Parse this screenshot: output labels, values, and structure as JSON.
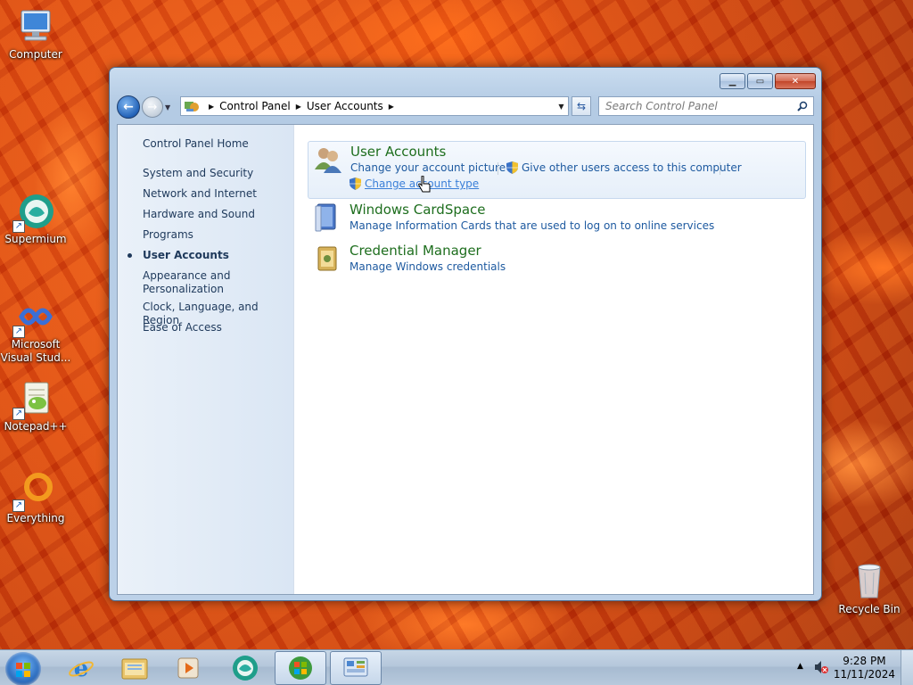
{
  "desktop": {
    "icons": [
      {
        "label": "Computer"
      },
      {
        "label": "Supermium"
      },
      {
        "label": "Microsoft Visual Stud..."
      },
      {
        "label": "Notepad++"
      },
      {
        "label": "Everything"
      },
      {
        "label": "Recycle Bin"
      }
    ]
  },
  "window": {
    "caption_buttons": {
      "minimize": "minimize-icon",
      "maximize": "maximize-icon",
      "close": "close-icon"
    },
    "address": {
      "crumbs": [
        "Control Panel",
        "User Accounts"
      ]
    },
    "search": {
      "placeholder": "Search Control Panel"
    },
    "left_pane": {
      "home": "Control Panel Home",
      "items": [
        {
          "label": "System and Security"
        },
        {
          "label": "Network and Internet"
        },
        {
          "label": "Hardware and Sound"
        },
        {
          "label": "Programs"
        },
        {
          "label": "User Accounts",
          "current": true
        },
        {
          "label": "Appearance and Personalization"
        },
        {
          "label": "Clock, Language, and Region"
        },
        {
          "label": "Ease of Access"
        }
      ]
    },
    "groups": [
      {
        "title": "User Accounts",
        "links": [
          "Change your account picture",
          "Give other users access to this computer",
          "Change account type"
        ]
      },
      {
        "title": "Windows CardSpace",
        "links": [
          "Manage Information Cards that are used to log on to online services"
        ]
      },
      {
        "title": "Credential Manager",
        "links": [
          "Manage Windows credentials"
        ]
      }
    ]
  },
  "taskbar": {
    "clock": {
      "time": "9:28 PM",
      "date": "11/11/2024"
    },
    "tray_icons": [
      "show-hidden-icons-arrow",
      "volume-muted-icon"
    ]
  },
  "colors": {
    "link": "#1e5aa0",
    "group_title": "#1e6e1e",
    "nav_text": "#1e395b"
  }
}
